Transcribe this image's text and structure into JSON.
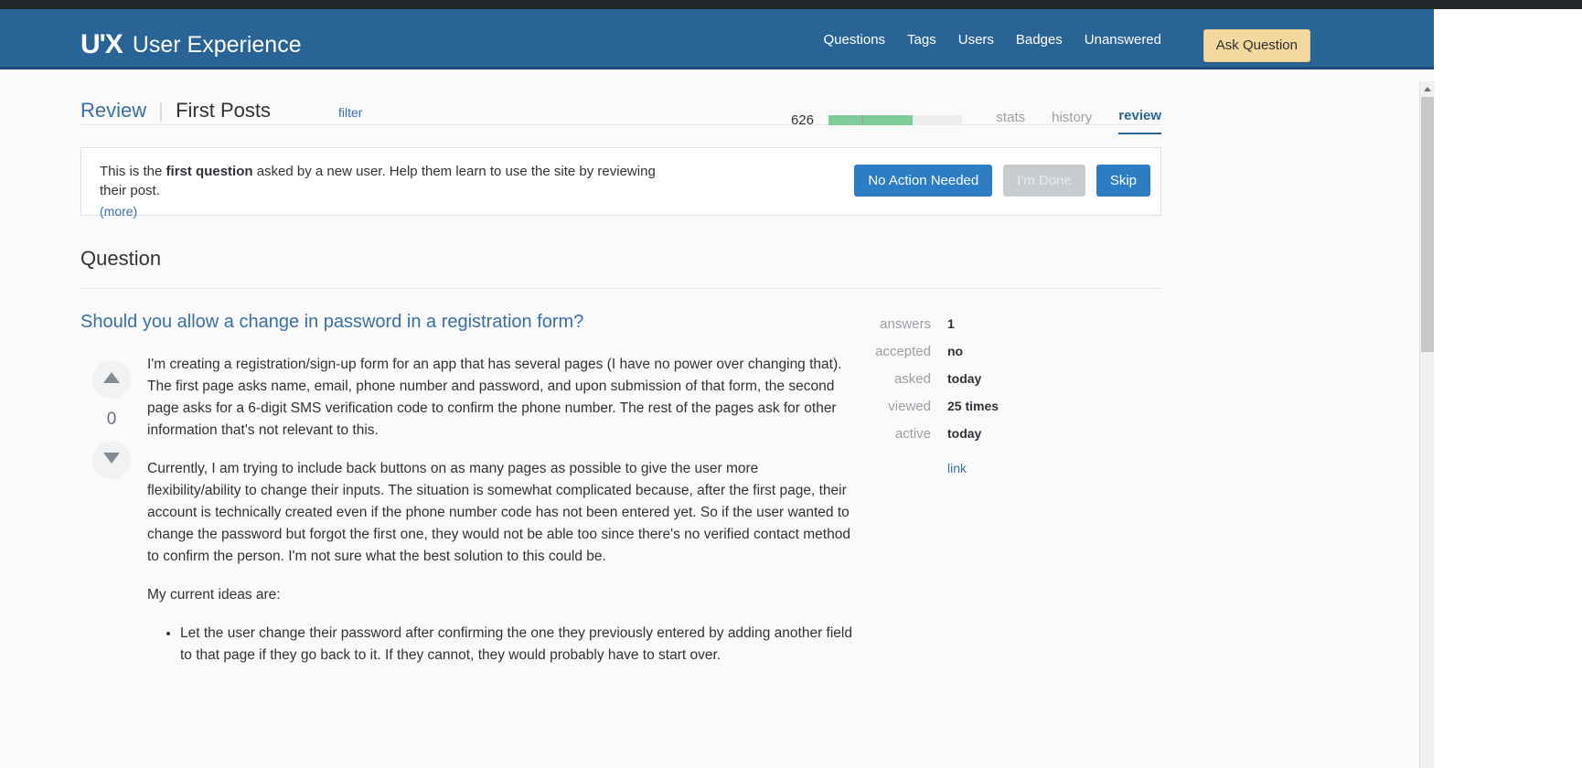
{
  "window": {
    "top_strip_color": "#232629"
  },
  "header": {
    "logo_mark": "U'X",
    "logo_text": "User Experience",
    "brand_color": "#2a6496",
    "nav": [
      {
        "label": "Questions"
      },
      {
        "label": "Tags"
      },
      {
        "label": "Users"
      },
      {
        "label": "Badges"
      },
      {
        "label": "Unanswered"
      }
    ],
    "ask_button": {
      "label": "Ask Question",
      "bg": "#f3d9a0",
      "fg": "#2f2f2f"
    }
  },
  "review": {
    "breadcrumb_root": "Review",
    "breadcrumb_sep": "|",
    "breadcrumb_current": "First Posts",
    "filter_label": "filter",
    "progress": {
      "count": "626",
      "fill_percent": 63,
      "marker_percent": 25,
      "fill_color": "#82cb9a",
      "track_color": "#eceded"
    },
    "subtabs": [
      {
        "label": "stats",
        "active": false
      },
      {
        "label": "history",
        "active": false
      },
      {
        "label": "review",
        "active": true
      }
    ]
  },
  "notice": {
    "text_before": "This is the ",
    "text_bold": "first question",
    "text_after": " asked by a new user. Help them learn to use the site by reviewing their post.",
    "more_label": "(more)",
    "actions": [
      {
        "label": "No Action Needed",
        "style": "primary"
      },
      {
        "label": "I'm Done",
        "style": "disabled"
      },
      {
        "label": "Skip",
        "style": "primary"
      }
    ]
  },
  "question_section": {
    "heading": "Question",
    "title": "Should you allow a change in password in a registration form?",
    "vote": {
      "up_icon": "triangle-up-icon",
      "down_icon": "triangle-down-icon",
      "count": "0"
    },
    "paragraphs": [
      "I'm creating a registration/sign-up form for an app that has several pages (I have no power over changing that). The first page asks name, email, phone number and password, and upon submission of that form, the second page asks for a 6-digit SMS verification code to confirm the phone number. The rest of the pages ask for other information that's not relevant to this.",
      "Currently, I am trying to include back buttons on as many pages as possible to give the user more flexibility/ability to change their inputs. The situation is somewhat complicated because, after the first page, their account is technically created even if the phone number code has not been entered yet. So if the user wanted to change the password but forgot the first one, they would not be able too since there's no verified contact method to confirm the person. I'm not sure what the best solution to this could be.",
      "My current ideas are:"
    ],
    "list_items": [
      "Let the user change their password after confirming the one they previously entered by adding another field to that page if they go back to it. If they cannot, they would probably have to start over."
    ],
    "stats": [
      {
        "label": "answers",
        "value": "1"
      },
      {
        "label": "accepted",
        "value": "no"
      },
      {
        "label": "asked",
        "value": "today"
      },
      {
        "label": "viewed",
        "value": "25 times"
      },
      {
        "label": "active",
        "value": "today"
      }
    ],
    "link_label": "link"
  },
  "scrollbar": {
    "up_arrow_icon": "triangle-up-icon",
    "thumb_color": "#c8c8c8"
  }
}
